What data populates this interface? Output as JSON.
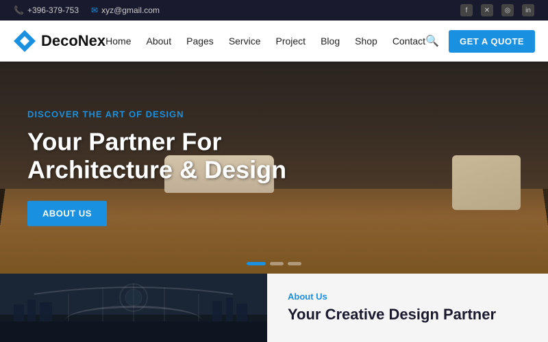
{
  "topbar": {
    "phone": "+396-379-753",
    "email": "xyz@gmail.com",
    "phone_icon": "📞",
    "email_icon": "✉",
    "socials": [
      "f",
      "𝕏",
      "📷",
      "in"
    ]
  },
  "navbar": {
    "logo_text": "DecoNex",
    "nav_links": [
      "Home",
      "About",
      "Pages",
      "Service",
      "Project",
      "Blog",
      "Shop",
      "Contact"
    ],
    "cta_label": "GET A QUOTE"
  },
  "hero": {
    "subtitle": "DISCOVER THE ART OF DESIGN",
    "title_line1": "Your Partner For",
    "title_line2": "Architecture & Design",
    "cta_label": "ABOUT US",
    "dots": [
      true,
      false,
      false
    ]
  },
  "about_section": {
    "label": "About Us",
    "heading_line1": "Your Creative Design Partner"
  }
}
